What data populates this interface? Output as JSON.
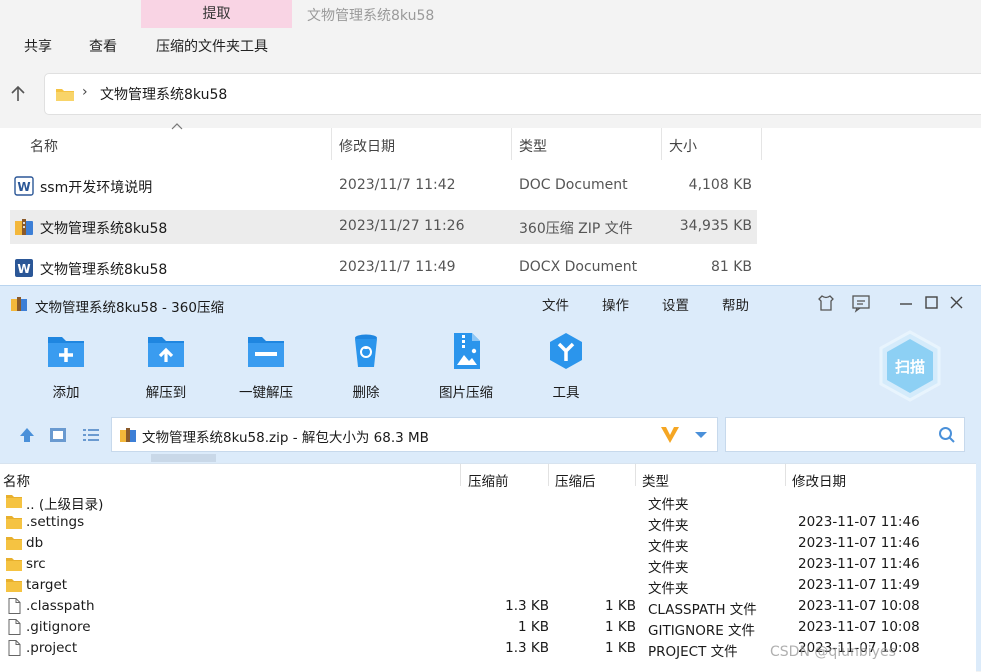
{
  "explorer": {
    "context_tab": "提取",
    "window_title": "文物管理系统8ku58",
    "menu_tabs": [
      "共享",
      "查看",
      "压缩的文件夹工具"
    ],
    "address": "文物管理系统8ku58",
    "columns": {
      "name": "名称",
      "date": "修改日期",
      "type": "类型",
      "size": "大小"
    },
    "files": [
      {
        "name": "ssm开发环境说明",
        "date": "2023/11/7 11:42",
        "type": "DOC Document",
        "size": "4,108 KB",
        "icon": "word-doc-icon"
      },
      {
        "name": "文物管理系统8ku58",
        "date": "2023/11/27 11:26",
        "type": "360压缩 ZIP 文件",
        "size": "34,935 KB",
        "icon": "zip-archive-icon"
      },
      {
        "name": "文物管理系统8ku58",
        "date": "2023/11/7 11:49",
        "type": "DOCX Document",
        "size": "81 KB",
        "icon": "word-doc-icon"
      }
    ]
  },
  "zip": {
    "title": "文物管理系统8ku58 - 360压缩",
    "menu": [
      "文件",
      "操作",
      "设置",
      "帮助"
    ],
    "tools": [
      {
        "label": "添加",
        "icon": "add-icon"
      },
      {
        "label": "解压到",
        "icon": "extract-to-icon"
      },
      {
        "label": "一键解压",
        "icon": "one-click-extract-icon"
      },
      {
        "label": "删除",
        "icon": "delete-icon"
      },
      {
        "label": "图片压缩",
        "icon": "image-compress-icon"
      },
      {
        "label": "工具",
        "icon": "tools-icon"
      }
    ],
    "scan_label": "扫描",
    "path": "文物管理系统8ku58.zip - 解包大小为 68.3 MB",
    "search_placeholder": "",
    "columns": {
      "name": "名称",
      "before": "压缩前",
      "after": "压缩后",
      "type": "类型",
      "date": "修改日期"
    },
    "rows": [
      {
        "name": ".. (上级目录)",
        "before": "",
        "after": "",
        "type": "文件夹",
        "date": "",
        "icon": "folder-icon"
      },
      {
        "name": ".settings",
        "before": "",
        "after": "",
        "type": "文件夹",
        "date": "2023-11-07 11:46",
        "icon": "folder-icon"
      },
      {
        "name": "db",
        "before": "",
        "after": "",
        "type": "文件夹",
        "date": "2023-11-07 11:46",
        "icon": "folder-icon"
      },
      {
        "name": "src",
        "before": "",
        "after": "",
        "type": "文件夹",
        "date": "2023-11-07 11:46",
        "icon": "folder-icon"
      },
      {
        "name": "target",
        "before": "",
        "after": "",
        "type": "文件夹",
        "date": "2023-11-07 11:49",
        "icon": "folder-icon"
      },
      {
        "name": ".classpath",
        "before": "1.3 KB",
        "after": "1 KB",
        "type": "CLASSPATH 文件",
        "date": "2023-11-07 10:08",
        "icon": "file-icon"
      },
      {
        "name": ".gitignore",
        "before": "1 KB",
        "after": "1 KB",
        "type": "GITIGNORE 文件",
        "date": "2023-11-07 10:08",
        "icon": "file-icon"
      },
      {
        "name": ".project",
        "before": "1.3 KB",
        "after": "1 KB",
        "type": "PROJECT 文件",
        "date": "2023-11-07 10:08",
        "icon": "file-icon"
      }
    ]
  },
  "watermark": "CSDN @qiunbiyes",
  "colors": {
    "accent_blue": "#2b8fe6",
    "zip_bg": "#dcebfa",
    "context_tab": "#f9d4e4",
    "folder": "#f5c342"
  }
}
